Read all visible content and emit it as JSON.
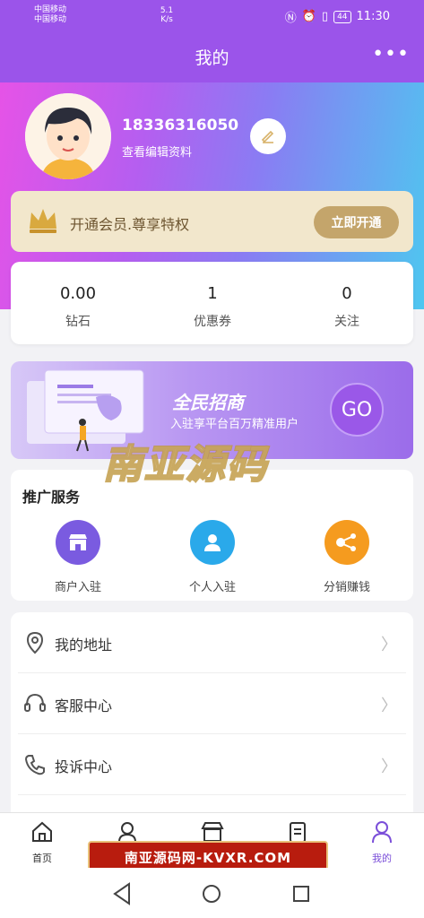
{
  "status_bar": {
    "carrier1": "中国移动",
    "carrier2": "中国移动",
    "speed": "5.1 K/s",
    "battery": "44",
    "time": "11:30"
  },
  "header": {
    "title": "我的",
    "more": "•••"
  },
  "profile": {
    "phone": "18336316050",
    "edit_link": "查看编辑资料"
  },
  "vip": {
    "text": "开通会员.尊享特权",
    "button": "立即开通"
  },
  "stats": [
    {
      "value": "0.00",
      "label": "钻石"
    },
    {
      "value": "1",
      "label": "优惠券"
    },
    {
      "value": "0",
      "label": "关注"
    }
  ],
  "banner": {
    "title": "全民招商",
    "subtitle": "入驻享平台百万精准用户",
    "go": "GO"
  },
  "watermark_big": "南亚源码",
  "promo": {
    "title": "推广服务",
    "items": [
      {
        "label": "商户入驻",
        "color": "#7a5be0"
      },
      {
        "label": "个人入驻",
        "color": "#2aa9ea"
      },
      {
        "label": "分销赚钱",
        "color": "#f59b1f"
      }
    ]
  },
  "menu": [
    {
      "label": "我的地址",
      "icon": "location-icon"
    },
    {
      "label": "客服中心",
      "icon": "headset-icon"
    },
    {
      "label": "投诉中心",
      "icon": "phone-icon"
    }
  ],
  "tabbar": [
    {
      "label": "首页",
      "icon": "home-icon"
    },
    {
      "label": "",
      "icon": "service-icon"
    },
    {
      "label": "",
      "icon": "store-icon"
    },
    {
      "label": "",
      "icon": "order-icon"
    },
    {
      "label": "我的",
      "icon": "user-icon"
    }
  ],
  "bottom_watermark": "南亚源码网-KVXR.COM",
  "colors": {
    "accent": "#7b4fd9",
    "vip_gold": "#c4a56b"
  }
}
